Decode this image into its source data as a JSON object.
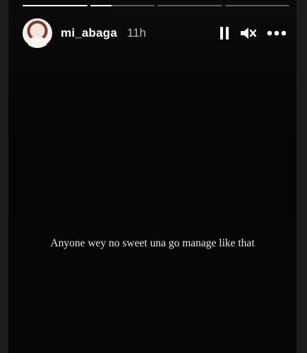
{
  "progress": {
    "segments": [
      1.0,
      0.33,
      0.0,
      0.0
    ]
  },
  "header": {
    "username": "mi_abaga",
    "time": "11h"
  },
  "controls": {
    "icons": [
      "pause-icon",
      "mute-icon",
      "more-options-icon"
    ]
  },
  "story": {
    "caption": "Anyone wey no sweet una go manage like that"
  },
  "colors": {
    "background": "#050505",
    "progress_fill": "#ffffff",
    "progress_track": "#5a5a5a",
    "text": "#ffffff",
    "muted_text": "#b9b9b9"
  }
}
